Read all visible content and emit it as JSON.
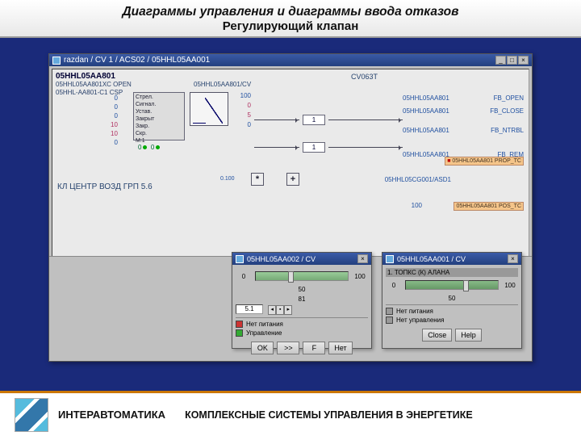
{
  "header": {
    "title_line1": "Диаграммы управления и диаграммы ввода отказов",
    "title_line2": "Регулирующий клапан"
  },
  "window": {
    "titlebar": "razdan / CV 1 / ACS02 / 05HHL05AA001",
    "winbuttons": {
      "min": "_",
      "max": "□",
      "close": "×"
    }
  },
  "diagram": {
    "main_tag": "05HHL05AA801",
    "sub_tag1": "05HHL05AA801XC  OPEN",
    "sub_tag2": "05HHL-AA801-C1  CSP",
    "cv_block": "05HHL05AA801/CV",
    "cv_type": "CV063T",
    "left_numbers": [
      "0",
      "0",
      "0",
      "10",
      "10",
      "0"
    ],
    "sigbox_lines": [
      "Стрел.",
      "Сигнал.",
      "Устав.",
      "Закрыт",
      "Закр.",
      "Скр.",
      "M:1"
    ],
    "sigbox_bottom": "0",
    "right_numbers_top": {
      "v1": "100",
      "v2": "0",
      "v3": "5",
      "v4": "0"
    },
    "right_numbers_bottom": {
      "v1": "0",
      "v2": "1"
    },
    "center_values": {
      "one_a": "1",
      "one_b": "1"
    },
    "op_labels": {
      "mul": "*",
      "add": "+"
    },
    "mul_in": "0.100",
    "kl_text": "КЛ ЦЕНТР ВОЗД ГРП 5.6",
    "fb_list": [
      {
        "tag": "05HHL05AA801",
        "sig": "FB_OPEN"
      },
      {
        "tag": "05HHL05AA801",
        "sig": "FB_CLOSE"
      },
      {
        "tag": "05HHL05AA801",
        "sig": "FB_NTRBL"
      },
      {
        "tag": "05HHL05AA801",
        "sig": "FB_REM"
      }
    ],
    "prop_tag": "05HHL05AA801  PROP_TC",
    "inner_tag": "05HHL05CG001/ASD1",
    "pos_tag_prefix": "100",
    "pos_tag": "05HHL05AA801  POS_TC"
  },
  "dialog1": {
    "title": "05HHL05AA002 / CV",
    "slider": {
      "min": "0",
      "mid": "50",
      "max": "100",
      "pos_pct": 35
    },
    "second_label": "81",
    "input_value": "5.1",
    "status": [
      {
        "color": "red",
        "label": "Нет питания"
      },
      {
        "color": "grn",
        "label": "Управление"
      }
    ],
    "buttons": {
      "ok": "OK",
      "apply": ">>",
      "f": "F",
      "cancel": "Нет"
    }
  },
  "dialog2": {
    "title": "05HHL05AA001 / CV",
    "sub_header": "1. ТОПКС (К) АЛАНА",
    "slider": {
      "min": "0",
      "mid": "50",
      "max": "100",
      "pos_pct": 62
    },
    "status": [
      {
        "color": "gry",
        "label": "Нет питания"
      },
      {
        "color": "gry",
        "label": "Нет управления"
      }
    ],
    "buttons": {
      "close": "Close",
      "help": "Help"
    }
  },
  "footer": {
    "brand": "ИНТЕРАВТОМАТИКА",
    "tagline": "КОМПЛЕКСНЫЕ СИСТЕМЫ УПРАВЛЕНИЯ В ЭНЕРГЕТИКЕ"
  }
}
